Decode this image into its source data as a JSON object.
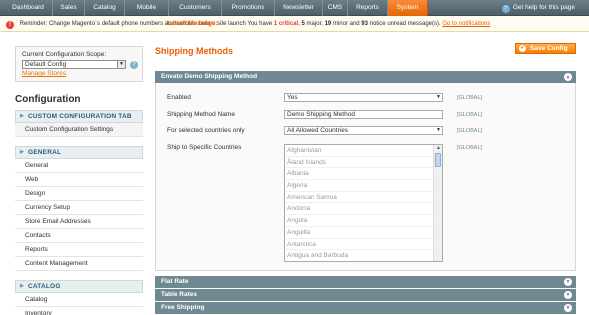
{
  "nav": {
    "items": [
      "Dashboard",
      "Sales",
      "Catalog",
      "Mobile",
      "Customers",
      "Promotions",
      "Newsletter",
      "CMS",
      "Reports",
      "System"
    ],
    "active": "System",
    "help": "Get help for this page"
  },
  "message": {
    "label": "Latest Message:",
    "text": " Reminder: Change Magento`s default phone numbers and callouts before site launch  You have ",
    "critical": "1 critical",
    "sep1": ", ",
    "major": "5",
    "major_text": " major, ",
    "minor": "19",
    "minor_text": " minor and ",
    "notice": "93",
    "notice_text": " notice unread message(s). ",
    "link": "Go to notifications"
  },
  "sidebar": {
    "scope_label": "Current Configuration Scope:",
    "scope_value": "Default Config",
    "manage_stores": "Manage Stores",
    "title": "Configuration",
    "sections": [
      {
        "title": "CUSTOM CONFIGURATION TAB",
        "items": [
          "Custom Configuration Settings"
        ]
      },
      {
        "title": "GENERAL",
        "items": [
          "General",
          "Web",
          "Design",
          "Currency Setup",
          "Store Email Addresses",
          "Contacts",
          "Reports",
          "Content Management"
        ]
      },
      {
        "title": "CATALOG",
        "items": [
          "Catalog",
          "Inventory"
        ]
      }
    ]
  },
  "main": {
    "title": "Shipping Methods",
    "save_label": "Save Config",
    "section_title": "Envato Demo Shipping Method",
    "fields": [
      {
        "label": "Enabled",
        "value": "Yes",
        "scope": "[GLOBAL]"
      },
      {
        "label": "Shipping Method Name",
        "value": "Demo Shipping Method",
        "scope": "[GLOBAL]"
      },
      {
        "label": "For selected countries only",
        "value": "All Allowed Countries",
        "scope": "[GLOBAL]"
      },
      {
        "label": "Ship to Specific Countries",
        "scope": "[GLOBAL]"
      }
    ],
    "countries": [
      "Afghanistan",
      "Åland Islands",
      "Albania",
      "Algeria",
      "American Samoa",
      "Andorra",
      "Angola",
      "Anguilla",
      "Antarctica",
      "Antigua and Barbuda"
    ],
    "collapsed_sections": [
      "Flat Rate",
      "Table Rates",
      "Free Shipping"
    ]
  }
}
